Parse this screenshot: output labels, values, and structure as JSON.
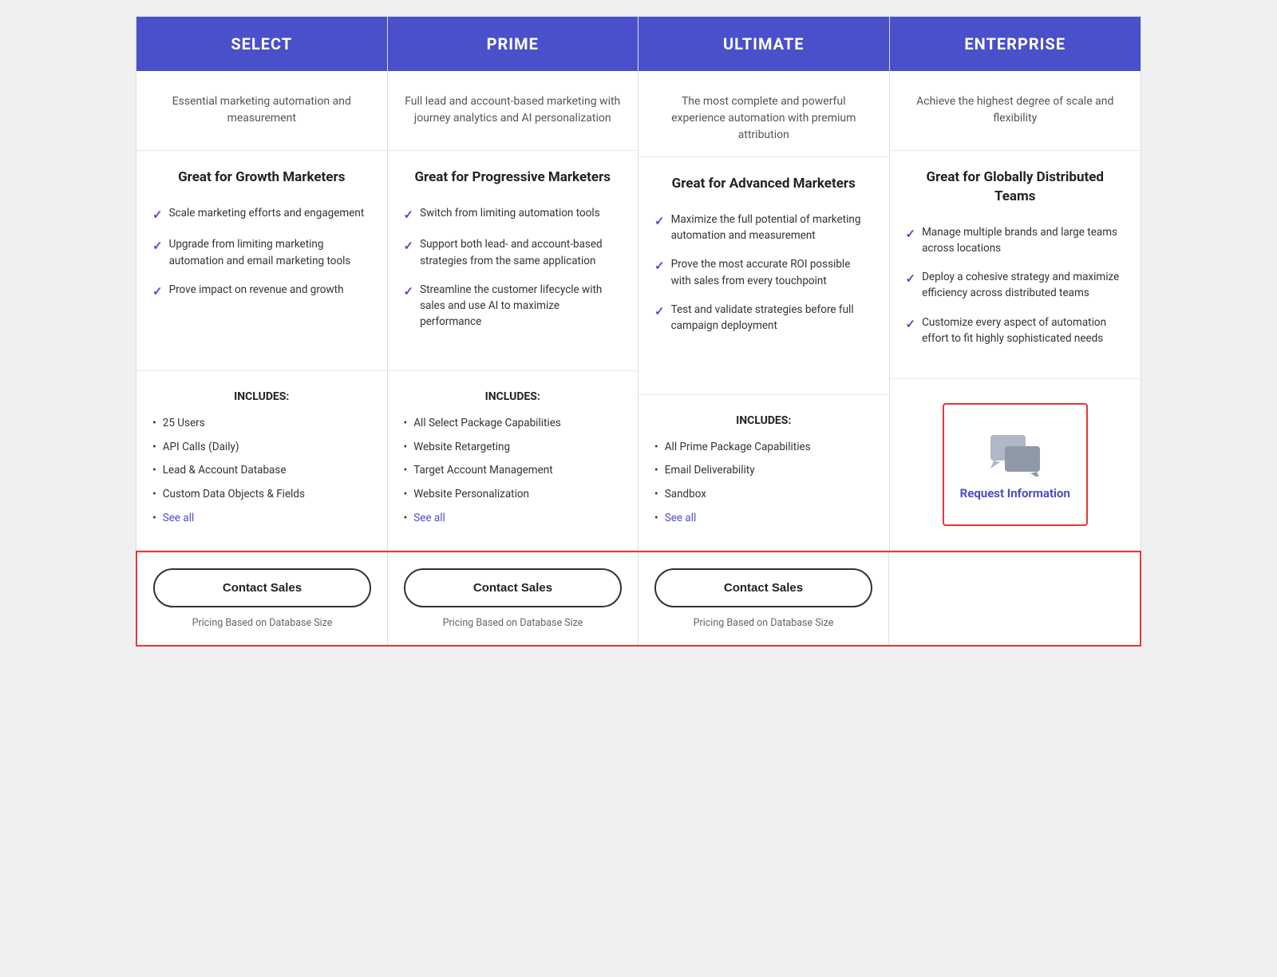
{
  "plans": [
    {
      "id": "select",
      "name": "SELECT",
      "description": "Essential marketing automation and measurement",
      "tagline": "Great for Growth Marketers",
      "bullets": [
        "Scale marketing efforts and engagement",
        "Upgrade from limiting marketing automation and email marketing tools",
        "Prove impact on revenue and growth"
      ],
      "includes_title": "INCLUDES:",
      "includes_items": [
        "25 Users",
        "API Calls (Daily)",
        "Lead & Account Database",
        "Custom Data Objects & Fields"
      ],
      "see_all_label": "See all",
      "cta_label": "Contact Sales",
      "pricing_note": "Pricing Based on Database Size"
    },
    {
      "id": "prime",
      "name": "PRIME",
      "description": "Full lead and account-based marketing with journey analytics and AI personalization",
      "tagline": "Great for Progressive Marketers",
      "bullets": [
        "Switch from limiting automation tools",
        "Support both lead- and account-based strategies from the same application",
        "Streamline the customer lifecycle with sales and use AI to maximize performance"
      ],
      "includes_title": "INCLUDES:",
      "includes_items": [
        "All Select Package Capabilities",
        "Website Retargeting",
        "Target Account Management",
        "Website Personalization"
      ],
      "see_all_label": "See all",
      "cta_label": "Contact Sales",
      "pricing_note": "Pricing Based on Database Size"
    },
    {
      "id": "ultimate",
      "name": "ULTIMATE",
      "description": "The most complete and powerful experience automation with premium attribution",
      "tagline": "Great for Advanced Marketers",
      "bullets": [
        "Maximize the full potential of marketing automation and measurement",
        "Prove the most accurate ROI possible with sales from every touchpoint",
        "Test and validate strategies before full campaign deployment"
      ],
      "includes_title": "INCLUDES:",
      "includes_items": [
        "All Prime Package Capabilities",
        "Email Deliverability",
        "Sandbox"
      ],
      "see_all_label": "See all",
      "cta_label": "Contact Sales",
      "pricing_note": "Pricing Based on Database Size"
    },
    {
      "id": "enterprise",
      "name": "ENTERPRISE",
      "description": "Achieve the highest degree of scale and flexibility",
      "tagline": "Great for Globally Distributed Teams",
      "bullets": [
        "Manage multiple brands and large teams across locations",
        "Deploy a cohesive strategy and maximize efficiency across distributed teams",
        "Customize every aspect of automation effort to fit highly sophisticated needs"
      ],
      "includes_title": "",
      "includes_items": [],
      "request_info_label": "Request Information"
    }
  ]
}
